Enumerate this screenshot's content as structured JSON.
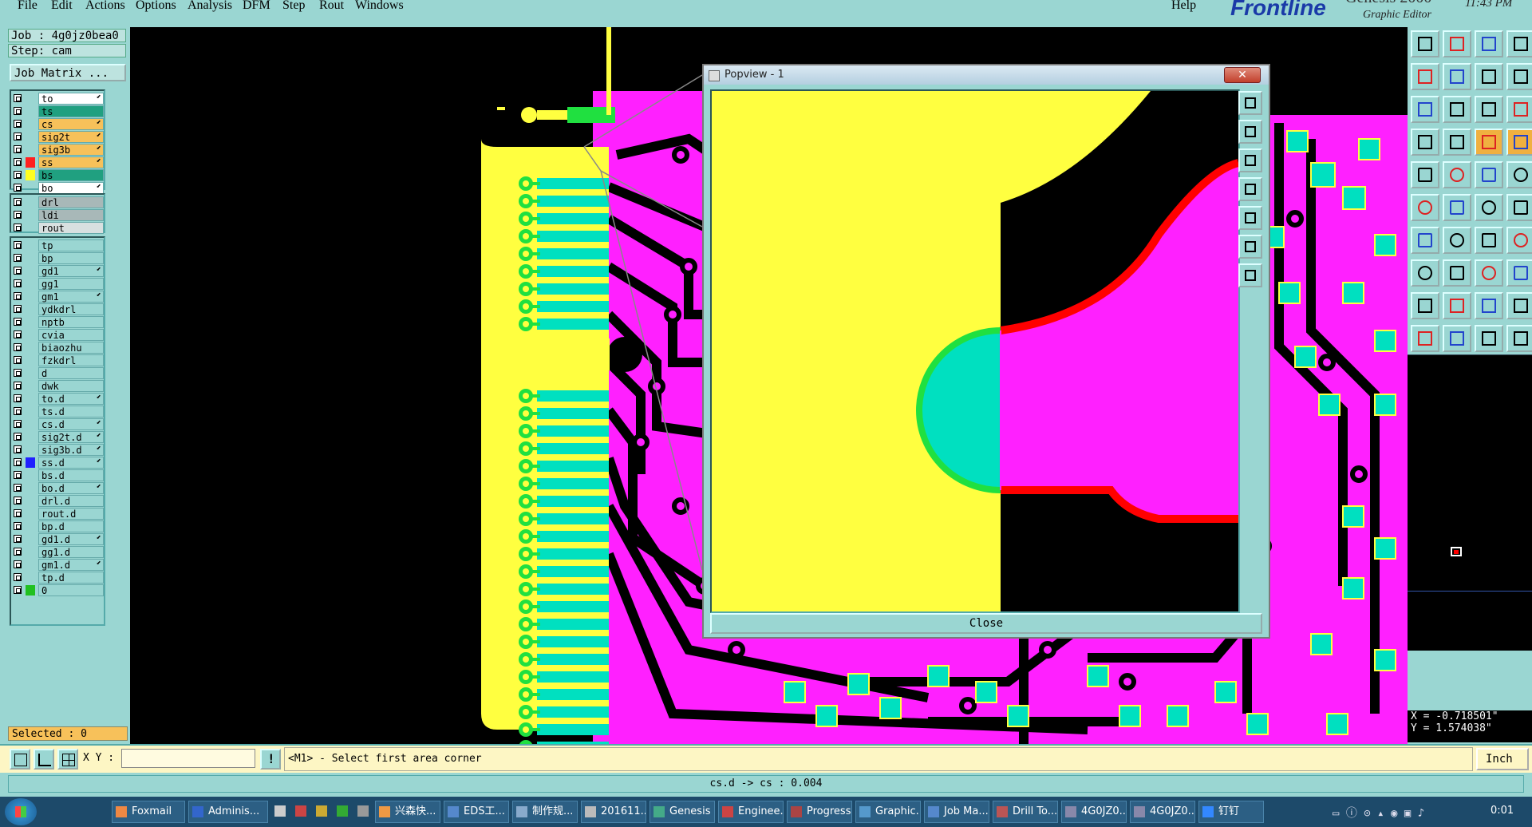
{
  "menu": {
    "items": [
      "File",
      "Edit",
      "Actions",
      "Options",
      "Analysis",
      "DFM",
      "Step",
      "Rout",
      "Windows"
    ],
    "help": "Help"
  },
  "brand": {
    "logo": "Frontline",
    "product": "Genesis 2000",
    "subtitle": "Graphic Editor",
    "time": "11:43 PM"
  },
  "job": {
    "job_label": "Job : 4g0jz0bea0",
    "step_label": "Step: cam",
    "matrix_button": "Job Matrix ..."
  },
  "layers": {
    "board": [
      {
        "name": "to",
        "color": "#ffffff",
        "swatch": "",
        "active": true
      },
      {
        "name": "ts",
        "color": "#20a080",
        "swatch": ""
      },
      {
        "name": "cs",
        "color": "#f7c15a",
        "swatch": "",
        "active": true
      },
      {
        "name": "sig2t",
        "color": "#f7c15a",
        "swatch": "",
        "active": true
      },
      {
        "name": "sig3b",
        "color": "#f7c15a",
        "swatch": "",
        "active": true
      },
      {
        "name": "ss",
        "color": "#f7c15a",
        "swatch": "#ff2020",
        "active": true,
        "selected": true
      },
      {
        "name": "bs",
        "color": "#20a080",
        "swatch": "#ffff20"
      },
      {
        "name": "bo",
        "color": "#ffffff",
        "swatch": "",
        "active": true
      }
    ],
    "drill": [
      {
        "name": "drl",
        "color": "#a8b8b8"
      },
      {
        "name": "ldi",
        "color": "#a8b8b8"
      },
      {
        "name": "rout",
        "color": "#d8e0e0"
      }
    ],
    "misc": [
      {
        "name": "tp"
      },
      {
        "name": "bp"
      },
      {
        "name": "gd1",
        "active": true
      },
      {
        "name": "gg1"
      },
      {
        "name": "gm1",
        "active": true
      },
      {
        "name": "ydkdrl"
      },
      {
        "name": "nptb"
      },
      {
        "name": "cvia"
      },
      {
        "name": "biaozhu"
      },
      {
        "name": "fzkdrl"
      },
      {
        "name": "d"
      },
      {
        "name": "dwk"
      },
      {
        "name": "to.d",
        "active": true
      },
      {
        "name": "ts.d"
      },
      {
        "name": "cs.d",
        "active": true
      },
      {
        "name": "sig2t.d",
        "active": true
      },
      {
        "name": "sig3b.d",
        "active": true
      },
      {
        "name": "ss.d",
        "swatch": "#2020ff",
        "active": true
      },
      {
        "name": "bs.d"
      },
      {
        "name": "bo.d",
        "active": true
      },
      {
        "name": "drl.d"
      },
      {
        "name": "rout.d"
      },
      {
        "name": "bp.d"
      },
      {
        "name": "gd1.d",
        "active": true
      },
      {
        "name": "gg1.d"
      },
      {
        "name": "gm1.d",
        "active": true
      },
      {
        "name": "tp.d"
      },
      {
        "name": "0",
        "swatch": "#20c020"
      }
    ]
  },
  "selected_label": "Selected : 0",
  "command": {
    "xy_label": "X Y :",
    "xy_value": "",
    "prompt": "<M1> - Select first area corner",
    "units": "Inch"
  },
  "status": {
    "text": "cs.d -> cs : 0.004"
  },
  "coords": {
    "x": "X = -0.718501\"",
    "y": "Y = 1.574038\""
  },
  "popview": {
    "title": "Popview - 1",
    "close_button": "Close"
  },
  "taskbar": {
    "items": [
      "Foxmail",
      "Adminis...",
      "",
      "",
      "",
      "",
      "",
      "兴森快...",
      "EDS工...",
      "制作规...",
      "201611...",
      "Genesis",
      "Enginee...",
      "Progress",
      "Graphic...",
      "Job Ma...",
      "Drill To...",
      "4G0JZ0...",
      "4G0JZ0...",
      "钉钉"
    ],
    "clock": "0:01"
  },
  "colors": {
    "panel": "#9ad6d2",
    "copper": "#ff20ff",
    "pad": "#00e0c0",
    "signal": "#ffff40",
    "highlight": "#ff0000",
    "outline": "#20e040"
  }
}
